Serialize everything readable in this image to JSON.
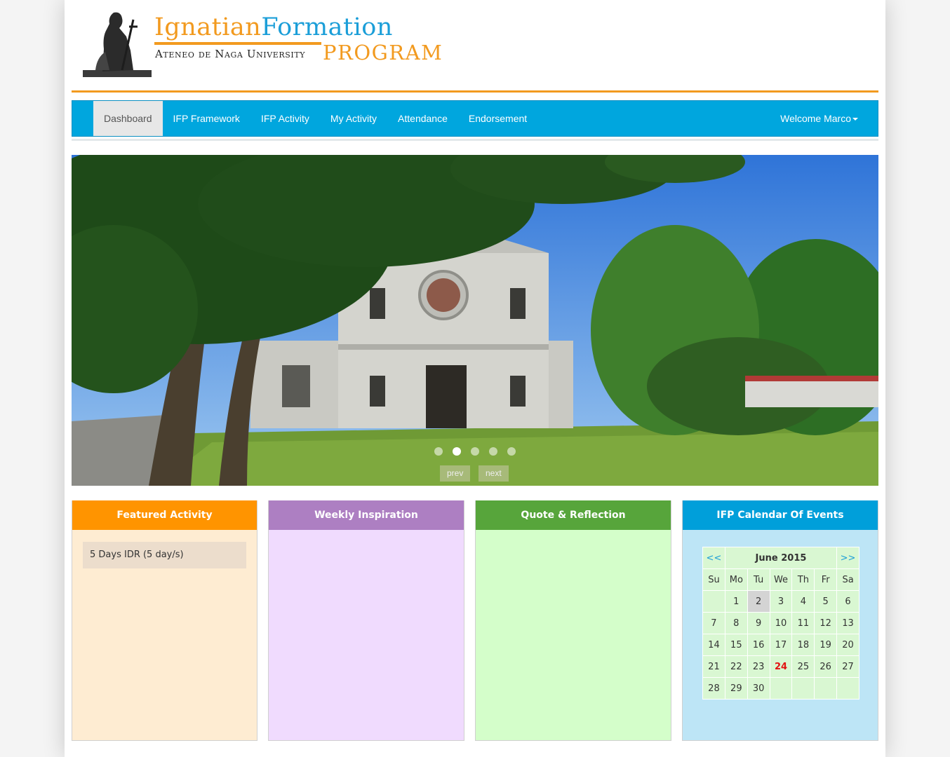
{
  "logo": {
    "title_part1": "IgnatianFormation",
    "title_first": "Ignatian",
    "title_second": "Formation",
    "subtitle": "Ateneo de Naga University",
    "program": "PROGRAM"
  },
  "nav": {
    "items": [
      {
        "label": "Dashboard",
        "active": true
      },
      {
        "label": "IFP Framework"
      },
      {
        "label": "IFP Activity"
      },
      {
        "label": "My Activity"
      },
      {
        "label": "Attendance"
      },
      {
        "label": "Endorsement"
      }
    ],
    "user": "Welcome Marco"
  },
  "carousel": {
    "active_index": 2,
    "slide_count": 5,
    "prev_label": "prev",
    "next_label": "next"
  },
  "panels": {
    "featured": {
      "title": "Featured Activity",
      "items": [
        "5 Days IDR (5 day/s)"
      ]
    },
    "weekly": {
      "title": "Weekly Inspiration"
    },
    "quote": {
      "title": "Quote & Reflection"
    },
    "calendar": {
      "title": "IFP Calendar Of Events",
      "prev": "<<",
      "next": ">>",
      "month": "June 2015",
      "weekdays": [
        "Su",
        "Mo",
        "Tu",
        "We",
        "Th",
        "Fr",
        "Sa"
      ],
      "weeks": [
        [
          "",
          "1",
          "2",
          "3",
          "4",
          "5",
          "6"
        ],
        [
          "7",
          "8",
          "9",
          "10",
          "11",
          "12",
          "13"
        ],
        [
          "14",
          "15",
          "16",
          "17",
          "18",
          "19",
          "20"
        ],
        [
          "21",
          "22",
          "23",
          "24",
          "25",
          "26",
          "27"
        ],
        [
          "28",
          "29",
          "30",
          "",
          "",
          "",
          ""
        ]
      ],
      "today": "2",
      "event_day": "24"
    }
  },
  "colors": {
    "orange": "#ff9400",
    "blue": "#00a6de",
    "purple": "#ad7fc2",
    "green": "#57a53b",
    "event_red": "#e21212"
  }
}
